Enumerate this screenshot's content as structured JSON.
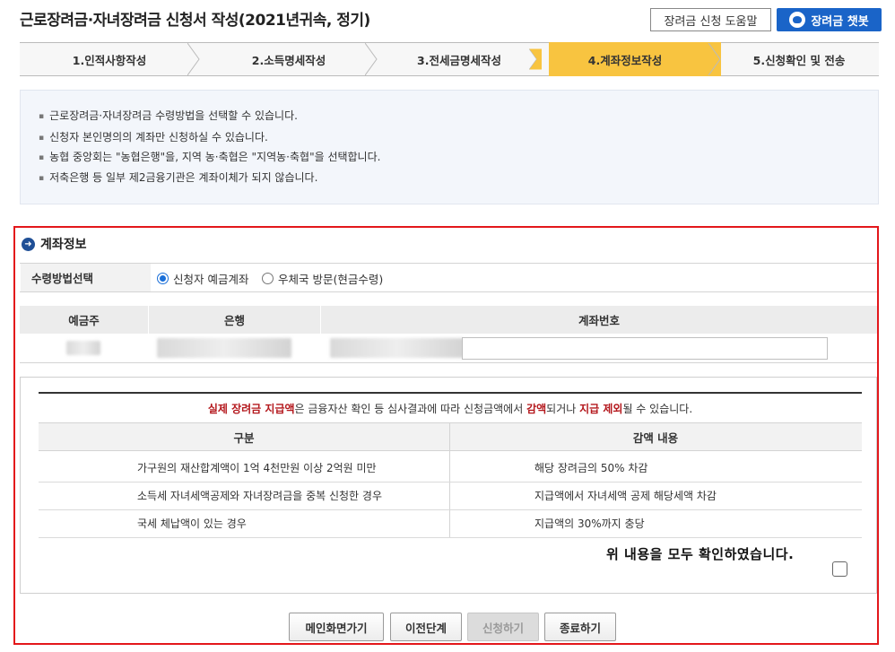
{
  "header": {
    "title": "근로장려금·자녀장려금 신청서 작성(2021년귀속, 정기)",
    "help_button": "장려금 신청 도움말",
    "chatbot_button": "장려금 챗봇"
  },
  "steps": [
    {
      "label": "1.인적사항작성",
      "active": false
    },
    {
      "label": "2.소득명세작성",
      "active": false
    },
    {
      "label": "3.전세금명세작성",
      "active": false
    },
    {
      "label": "4.계좌정보작성",
      "active": true
    },
    {
      "label": "5.신청확인 및 전송",
      "active": false
    }
  ],
  "info": {
    "lines": [
      "근로장려금·자녀장려금 수령방법을 선택할 수 있습니다.",
      "신청자 본인명의의 계좌만 신청하실 수 있습니다.",
      "농협 중앙회는 \"농협은행\"을, 지역 농·축협은 \"지역농·축협\"을 선택합니다.",
      "저축은행 등 일부 제2금융기관은 계좌이체가 되지 않습니다."
    ]
  },
  "account_section": {
    "title": "계좌정보",
    "method_label": "수령방법선택",
    "method_options": [
      {
        "label": "신청자 예금계좌",
        "selected": true
      },
      {
        "label": "우체국 방문(현금수령)",
        "selected": false
      }
    ],
    "columns": {
      "holder": "예금주",
      "bank": "은행",
      "account_number": "계좌번호"
    },
    "account_number_value": ""
  },
  "notice": {
    "text_parts": [
      "실제 장려금 지급액",
      "은 금융자산 확인 등 심사결과에 따라 신청금액에서 ",
      "감액",
      "되거나 ",
      "지급 제외",
      "될 수 있습니다."
    ],
    "headers": {
      "category": "구분",
      "reduction": "감액 내용"
    },
    "rows": [
      {
        "category": "가구원의 재산합계액이 1억 4천만원 이상 2억원 미만",
        "reduction": "해당 장려금의 50% 차감"
      },
      {
        "category": "소득세 자녀세액공제와 자녀장려금을 중복 신청한 경우",
        "reduction": "지급액에서 자녀세액 공제 해당세액 차감"
      },
      {
        "category": "국세 체납액이 있는 경우",
        "reduction": "지급액의 30%까지 충당"
      }
    ],
    "confirm_label": "위 내용을 모두 확인하였습니다.",
    "confirm_checked": false
  },
  "footer": {
    "main_button": "메인화면가기",
    "prev_button": "이전단계",
    "apply_button": "신청하기",
    "exit_button": "종료하기"
  },
  "colors": {
    "accent_blue": "#1a64c8",
    "step_active": "#f8c440",
    "highlight_red": "#e3171b",
    "emphasis": "#b4181d"
  }
}
